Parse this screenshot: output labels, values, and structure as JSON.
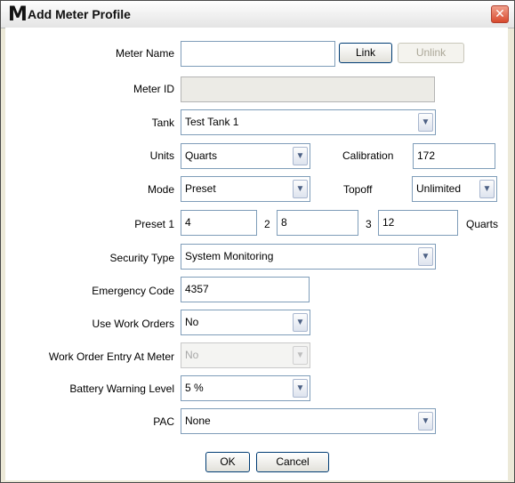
{
  "window": {
    "logo": "M",
    "title": "Add Meter Profile",
    "close_glyph": "✕"
  },
  "form": {
    "meter_name": {
      "label": "Meter Name",
      "value": ""
    },
    "link_button": "Link",
    "unlink_button": "Unlink",
    "meter_id": {
      "label": "Meter ID",
      "value": ""
    },
    "tank": {
      "label": "Tank",
      "value": "Test Tank 1"
    },
    "units": {
      "label": "Units",
      "value": "Quarts"
    },
    "calibration": {
      "label": "Calibration",
      "value": "172"
    },
    "mode": {
      "label": "Mode",
      "value": "Preset"
    },
    "topoff": {
      "label": "Topoff",
      "value": "Unlimited"
    },
    "presets": {
      "label1": "Preset 1",
      "value1": "4",
      "label2": "2",
      "value2": "8",
      "label3": "3",
      "value3": "12",
      "unit": "Quarts"
    },
    "security_type": {
      "label": "Security Type",
      "value": "System Monitoring"
    },
    "emergency_code": {
      "label": "Emergency Code",
      "value": "4357"
    },
    "use_work_orders": {
      "label": "Use Work Orders",
      "value": "No"
    },
    "work_order_entry": {
      "label": "Work Order Entry At Meter",
      "value": "No"
    },
    "battery_warning": {
      "label": "Battery Warning Level",
      "value": "5 %"
    },
    "pac": {
      "label": "PAC",
      "value": "None"
    }
  },
  "buttons": {
    "ok": "OK",
    "cancel": "Cancel"
  },
  "icons": {
    "dropdown": "chevron-down-icon",
    "close": "close-icon"
  }
}
